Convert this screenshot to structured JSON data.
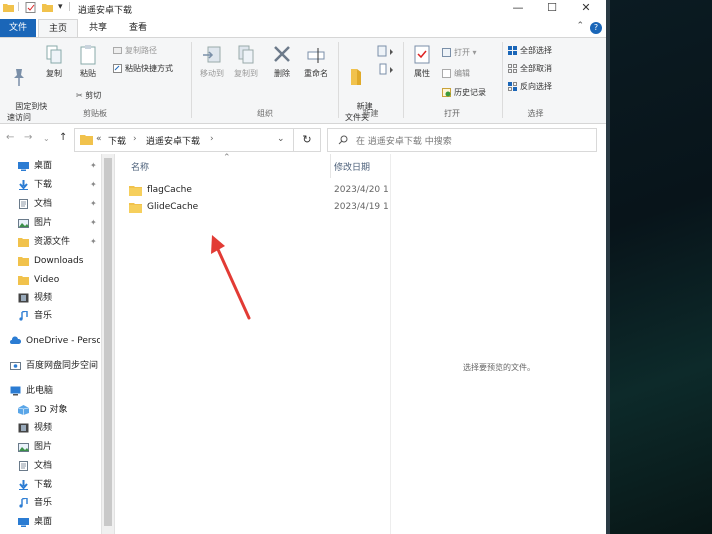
{
  "window": {
    "title": "逍遥安卓下载",
    "controls": {
      "minimize": "—",
      "maximize": "☐",
      "close": "✕"
    }
  },
  "tabs": {
    "file": "文件",
    "home": "主页",
    "share": "共享",
    "view": "查看",
    "help": "?"
  },
  "ribbon": {
    "clipboard": {
      "pin": "固定到快\n速访问",
      "copy": "复制",
      "paste": "粘贴",
      "copy_path": "复制路径",
      "paste_shortcut": "粘贴快捷方式",
      "cut": "剪切",
      "group": "剪贴板"
    },
    "organize": {
      "move_to": "移动到",
      "copy_to": "复制到",
      "delete": "删除",
      "rename": "重命名",
      "group": "组织"
    },
    "new": {
      "new_folder": "新建\n文件夹",
      "group": "新建"
    },
    "open": {
      "properties": "属性",
      "open": "打开",
      "edit": "编辑",
      "history": "历史记录",
      "group": "打开"
    },
    "select": {
      "select_all": "全部选择",
      "select_none": "全部取消",
      "invert": "反向选择",
      "group": "选择"
    }
  },
  "address": {
    "prefix": "«",
    "crumbs": [
      "下载",
      "逍遥安卓下载"
    ],
    "search_placeholder": "在 逍遥安卓下载 中搜索"
  },
  "nav": {
    "quick": [
      {
        "label": "桌面",
        "icon": "desktop-icon",
        "pinned": true
      },
      {
        "label": "下载",
        "icon": "download-icon",
        "pinned": true
      },
      {
        "label": "文档",
        "icon": "document-icon",
        "pinned": true
      },
      {
        "label": "图片",
        "icon": "picture-icon",
        "pinned": true
      },
      {
        "label": "资源文件",
        "icon": "folder-icon",
        "pinned": true
      },
      {
        "label": "Downloads",
        "icon": "folder-icon",
        "pinned": false
      },
      {
        "label": "Video",
        "icon": "folder-icon",
        "pinned": false
      },
      {
        "label": "视频",
        "icon": "video-icon",
        "pinned": false
      },
      {
        "label": "音乐",
        "icon": "music-icon",
        "pinned": false
      }
    ],
    "onedrive": "OneDrive - Perso",
    "baidu": "百度网盘同步空间",
    "thispc": "此电脑",
    "pc": [
      {
        "label": "3D 对象",
        "icon": "3d-objects-icon"
      },
      {
        "label": "视频",
        "icon": "video-icon"
      },
      {
        "label": "图片",
        "icon": "picture-icon"
      },
      {
        "label": "文档",
        "icon": "document-icon"
      },
      {
        "label": "下载",
        "icon": "download-icon"
      },
      {
        "label": "音乐",
        "icon": "music-icon"
      },
      {
        "label": "桌面",
        "icon": "desktop-icon"
      }
    ]
  },
  "list": {
    "columns": {
      "name": "名称",
      "modified": "修改日期"
    },
    "files": [
      {
        "name": "flagCache",
        "date": "2023/4/20 1"
      },
      {
        "name": "GlideCache",
        "date": "2023/4/19 1"
      }
    ]
  },
  "preview": {
    "text": "选择要预览的文件。"
  },
  "colors": {
    "accent": "#1a66b8",
    "folder": "#f1c24c",
    "arrow": "#e23b35"
  }
}
